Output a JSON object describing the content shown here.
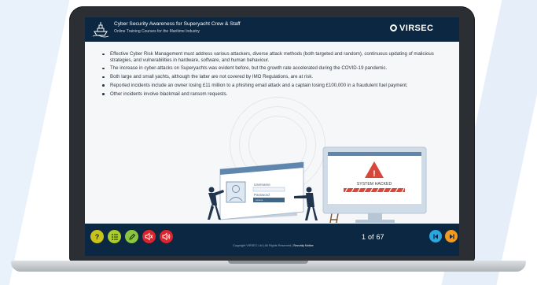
{
  "course": {
    "title": "Cyber Security Awareness for Superyacht Crew & Staff",
    "subtitle": "Online Training Courses for the Maritime Industry",
    "brand": "VIRSEC"
  },
  "bullets": [
    "Effective Cyber Risk Management must address various attackers, diverse attack methods (both targeted and random), continuous updating of malicious strategies, and vulnerabilities in hardware, software, and human behaviour.",
    "The increase in cyber-attacks on Superyachts was evident before, but the growth rate accelerated during the COVID-19 pandemic.",
    "Both large and small yachts, although the latter are not covered by IMO Regulations, are at risk.",
    "Reported incidents include an owner losing £11 million to a phishing email attack and a captain losing £100,000 in a fraudulent fuel payment.",
    "Other incidents involve blackmail and ransom requests."
  ],
  "illustration": {
    "login_username": "Username",
    "login_password": "Password",
    "password_mask": "******",
    "monitor_text": "SYSTEM HACKED"
  },
  "footer": {
    "help_glyph": "?",
    "copyright": "Copyright VIRSEC Ltd | All Rights Reserved |",
    "security_notice": "Security Notice",
    "page_current": "1",
    "page_of": "of",
    "page_total": "67"
  },
  "colors": {
    "navy": "#0c2741",
    "help": "#c8c21d",
    "menu": "#a8cc2c",
    "tools": "#8cc63f",
    "audio": "#d9262e",
    "prev": "#29a8e0",
    "next": "#f39a1e",
    "alert": "#d8473a"
  },
  "icons": {
    "help": "question-icon",
    "menu": "list-icon",
    "edit": "pencil-icon",
    "audio_off": "speaker-mute-icon",
    "audio_on": "speaker-sound-icon",
    "prev": "first-page-icon",
    "next": "next-page-icon"
  }
}
